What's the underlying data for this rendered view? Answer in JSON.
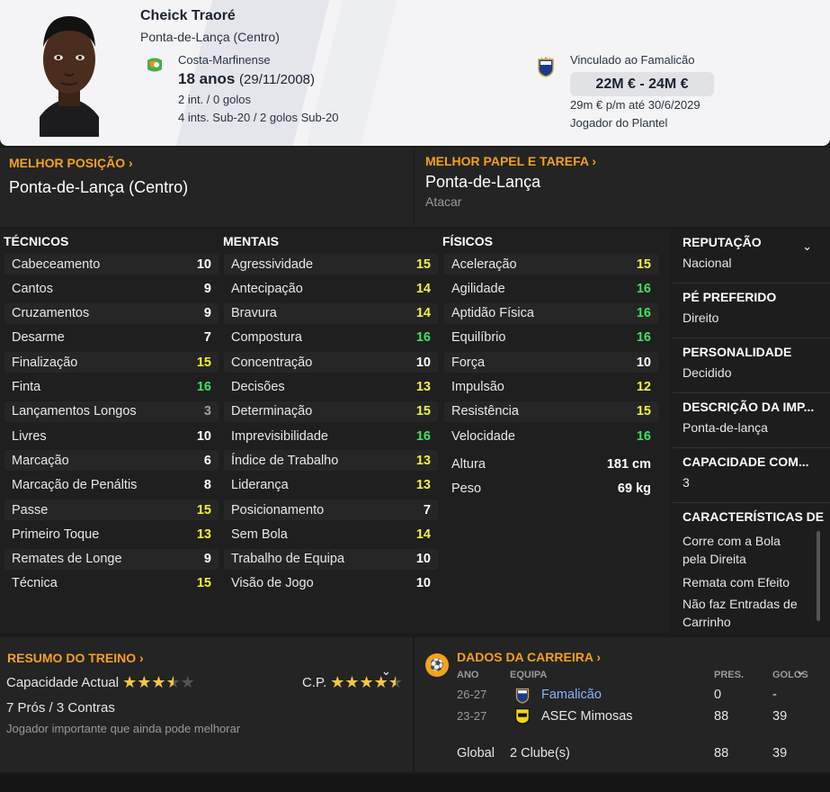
{
  "player": {
    "name": "Cheick Traoré",
    "position": "Ponta-de-Lança (Centro)",
    "nationality": "Costa-Marfinense",
    "age": "18 anos",
    "birth": "(29/11/2008)",
    "caps": "2 int. / 0 golos",
    "caps_u20": "4 ints. Sub-20 / 2 golos Sub-20"
  },
  "contract": {
    "label": "Vinculado ao Famalicão",
    "value": "22M € - 24M €",
    "wage": "29m € p/m até 30/6/2029",
    "status": "Jogador do Plantel"
  },
  "best_position": {
    "title": "MELHOR POSIÇÃO",
    "value": "Ponta-de-Lança (Centro)"
  },
  "best_role": {
    "title": "MELHOR PAPEL E TAREFA",
    "value": "Ponta-de-Lança",
    "duty": "Atacar"
  },
  "technical": {
    "title": "TÉCNICOS",
    "rows": [
      {
        "label": "Cabeceamento",
        "value": "10"
      },
      {
        "label": "Cantos",
        "value": "9"
      },
      {
        "label": "Cruzamentos",
        "value": "9"
      },
      {
        "label": "Desarme",
        "value": "7"
      },
      {
        "label": "Finalização",
        "value": "15"
      },
      {
        "label": "Finta",
        "value": "16"
      },
      {
        "label": "Lançamentos Longos",
        "value": "3"
      },
      {
        "label": "Livres",
        "value": "10"
      },
      {
        "label": "Marcação",
        "value": "6"
      },
      {
        "label": "Marcação de Penáltis",
        "value": "8"
      },
      {
        "label": "Passe",
        "value": "15"
      },
      {
        "label": "Primeiro Toque",
        "value": "13"
      },
      {
        "label": "Remates de Longe",
        "value": "9"
      },
      {
        "label": "Técnica",
        "value": "15"
      }
    ]
  },
  "mental": {
    "title": "MENTAIS",
    "rows": [
      {
        "label": "Agressividade",
        "value": "15"
      },
      {
        "label": "Antecipação",
        "value": "14"
      },
      {
        "label": "Bravura",
        "value": "14"
      },
      {
        "label": "Compostura",
        "value": "16"
      },
      {
        "label": "Concentração",
        "value": "10"
      },
      {
        "label": "Decisões",
        "value": "13"
      },
      {
        "label": "Determinação",
        "value": "15"
      },
      {
        "label": "Imprevisibilidade",
        "value": "16"
      },
      {
        "label": "Índice de Trabalho",
        "value": "13"
      },
      {
        "label": "Liderança",
        "value": "13"
      },
      {
        "label": "Posicionamento",
        "value": "7"
      },
      {
        "label": "Sem Bola",
        "value": "14"
      },
      {
        "label": "Trabalho de Equipa",
        "value": "10"
      },
      {
        "label": "Visão de Jogo",
        "value": "10"
      }
    ]
  },
  "physical": {
    "title": "FÍSICOS",
    "rows": [
      {
        "label": "Aceleração",
        "value": "15"
      },
      {
        "label": "Agilidade",
        "value": "16"
      },
      {
        "label": "Aptidão Física",
        "value": "16"
      },
      {
        "label": "Equilíbrio",
        "value": "16"
      },
      {
        "label": "Força",
        "value": "10"
      },
      {
        "label": "Impulsão",
        "value": "12"
      },
      {
        "label": "Resistência",
        "value": "15"
      },
      {
        "label": "Velocidade",
        "value": "16"
      }
    ],
    "height_label": "Altura",
    "height": "181 cm",
    "weight_label": "Peso",
    "weight": "69 kg"
  },
  "info": {
    "reputation_title": "REPUTAÇÃO",
    "reputation": "Nacional",
    "foot_title": "PÉ PREFERIDO",
    "foot": "Direito",
    "personality_title": "PERSONALIDADE",
    "personality": "Decidido",
    "media_title": "DESCRIÇÃO DA IMP...",
    "media": "Ponta-de-lança",
    "ability_title": "CAPACIDADE COM...",
    "ability": "3",
    "traits_title": "CARACTERÍSTICAS DE",
    "traits": [
      "Corre com a Bola",
      "pela Direita",
      "Remata com Efeito",
      "Não faz Entradas de",
      "Carrinho"
    ]
  },
  "training": {
    "title": "RESUMO DO TREINO",
    "ca_label": "Capacidade Actual",
    "ca_stars": 3.5,
    "pa_label": "C.P.",
    "pa_stars": 4.5,
    "pros_cons": "7 Prós / 3 Contras",
    "note": "Jogador importante que ainda pode melhorar"
  },
  "career": {
    "title": "DADOS DA CARREIRA",
    "headers": {
      "year": "ANO",
      "team": "EQUIPA",
      "apps": "PRES.",
      "goals": "GOLOS"
    },
    "rows": [
      {
        "year": "26-27",
        "team": "Famalicão",
        "apps": "0",
        "goals": "-"
      },
      {
        "year": "23-27",
        "team": "ASEC Mimosas",
        "apps": "88",
        "goals": "39"
      }
    ],
    "total": {
      "label": "Global",
      "team": "2 Clube(s)",
      "apps": "88",
      "goals": "39"
    }
  },
  "colors": {
    "accent": "#f4a21e",
    "attr_high": "#40e060",
    "attr_mid": "#f2f23a",
    "attr_low": "#ffffff"
  }
}
